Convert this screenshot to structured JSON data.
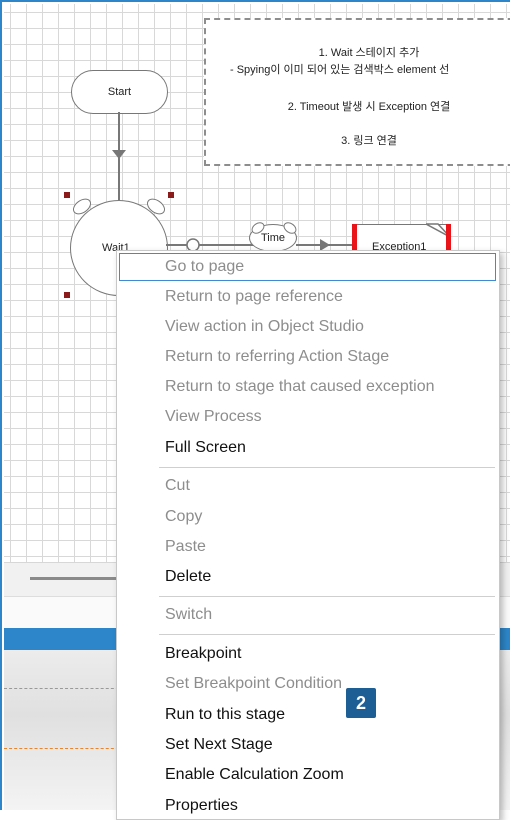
{
  "note": {
    "lines": [
      "1. Wait 스테이지 추가",
      "- Spying이 이미 되어 있는 검색박스 element 선",
      "2. Timeout 발생 시 Exception 연결",
      "3. 링크 연결"
    ]
  },
  "stages": {
    "start": "Start",
    "wait": "Wait1",
    "time": "Time",
    "exception": "Exception1"
  },
  "menu": {
    "items": [
      {
        "label": "Go to page",
        "enabled": false
      },
      {
        "label": "Return to page reference",
        "enabled": false
      },
      {
        "label": "View action in Object Studio",
        "enabled": false
      },
      {
        "label": "Return to referring Action Stage",
        "enabled": false
      },
      {
        "label": "Return to stage that caused exception",
        "enabled": false
      },
      {
        "label": "View Process",
        "enabled": false
      },
      {
        "label": "Full Screen",
        "enabled": true
      },
      {
        "label": "Cut",
        "enabled": false
      },
      {
        "label": "Copy",
        "enabled": false
      },
      {
        "label": "Paste",
        "enabled": false
      },
      {
        "label": "Delete",
        "enabled": true
      },
      {
        "label": "Switch",
        "enabled": false
      },
      {
        "label": "Breakpoint",
        "enabled": true
      },
      {
        "label": "Set Breakpoint Condition",
        "enabled": false
      },
      {
        "label": "Run to this stage",
        "enabled": true
      },
      {
        "label": "Set Next Stage",
        "enabled": true
      },
      {
        "label": "Enable Calculation Zoom",
        "enabled": true
      },
      {
        "label": "Properties",
        "enabled": true
      }
    ]
  },
  "callout": {
    "number": "2"
  },
  "colors": {
    "accent": "#2d86c9",
    "badge": "#1d5f95",
    "breakpoint_handle": "#8b1b1b",
    "exception_bar": "#e8141a"
  }
}
